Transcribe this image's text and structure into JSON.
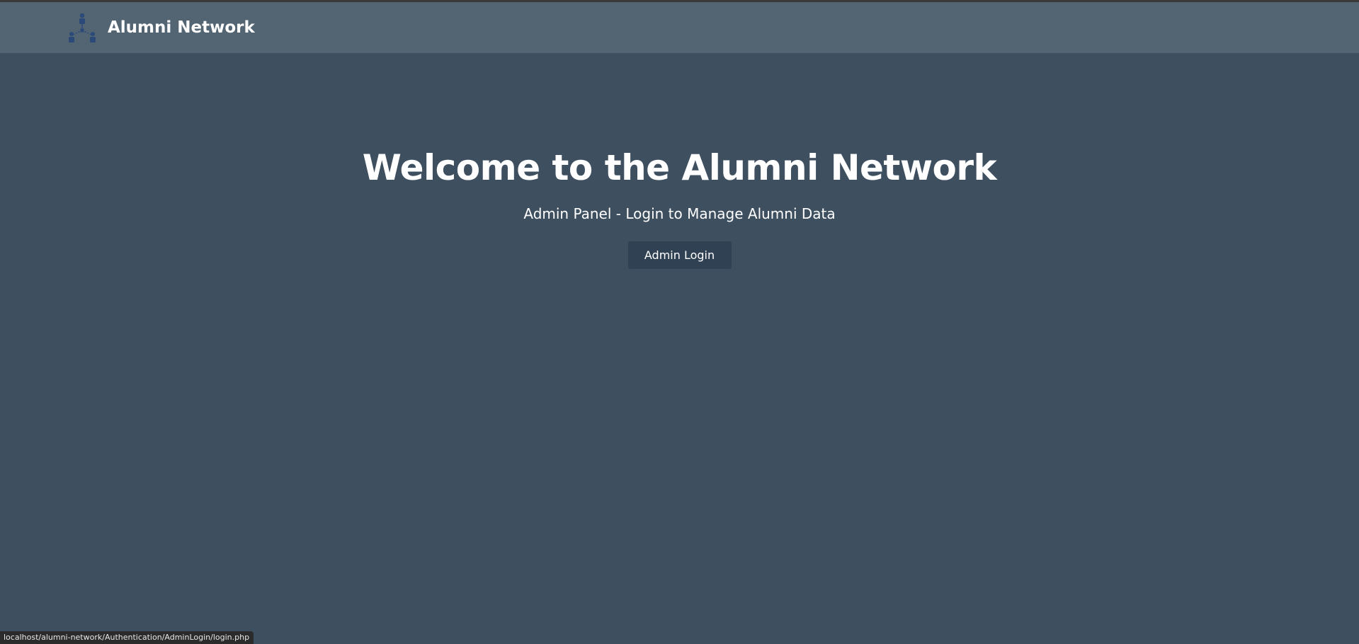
{
  "navbar": {
    "brand_name": "Alumni Network",
    "brand_icon": "network-icon",
    "icon_color": "#2b4a7a"
  },
  "hero": {
    "title": "Welcome to the Alumni Network",
    "subtitle": "Admin Panel - Login to Manage Alumni Data",
    "button_label": "Admin Login"
  },
  "status_bar": {
    "url": "localhost/alumni-network/Authentication/AdminLogin/login.php"
  },
  "colors": {
    "page_background": "#3e4f60",
    "navbar_background": "#536473",
    "button_background": "#2f4153",
    "text": "#ffffff"
  }
}
